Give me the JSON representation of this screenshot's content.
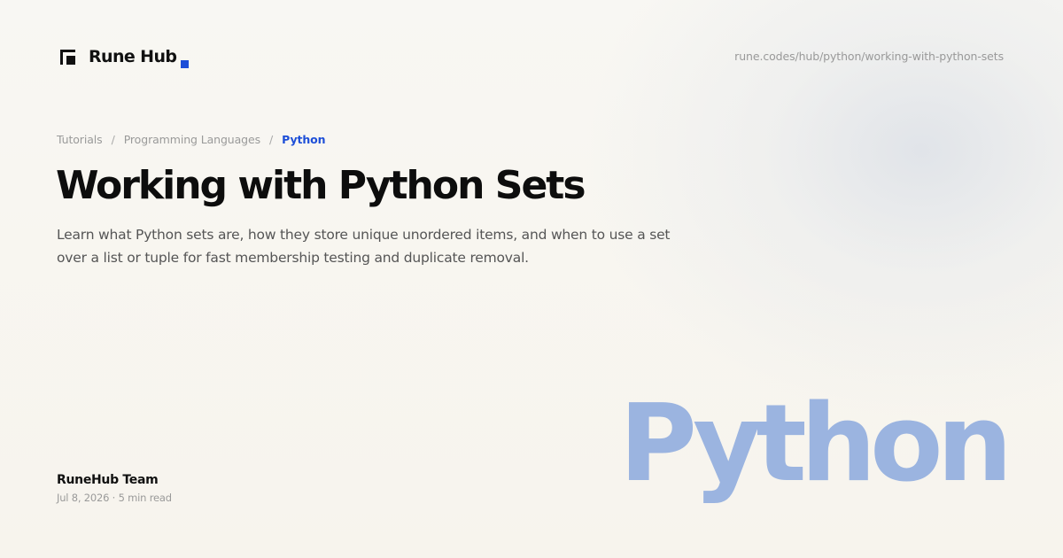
{
  "brand": {
    "name": "Rune Hub",
    "accent_color": "#1d4ed8",
    "logo_icon": "corner-square-icon"
  },
  "url": "rune.codes/hub/python/working-with-python-sets",
  "breadcrumb": {
    "items": [
      "Tutorials",
      "Programming Languages"
    ],
    "separator": "/",
    "current": "Python"
  },
  "article": {
    "title": "Working with Python Sets",
    "description": "Learn what Python sets are, how they store unique unordered items, and when to use a set over a list or tuple for fast membership testing and duplicate removal."
  },
  "author": {
    "name": "RuneHub Team",
    "meta": "Jul 8, 2026 · 5 min read"
  },
  "topic_badge": {
    "text": "Python",
    "color": "#9bb4e0"
  }
}
